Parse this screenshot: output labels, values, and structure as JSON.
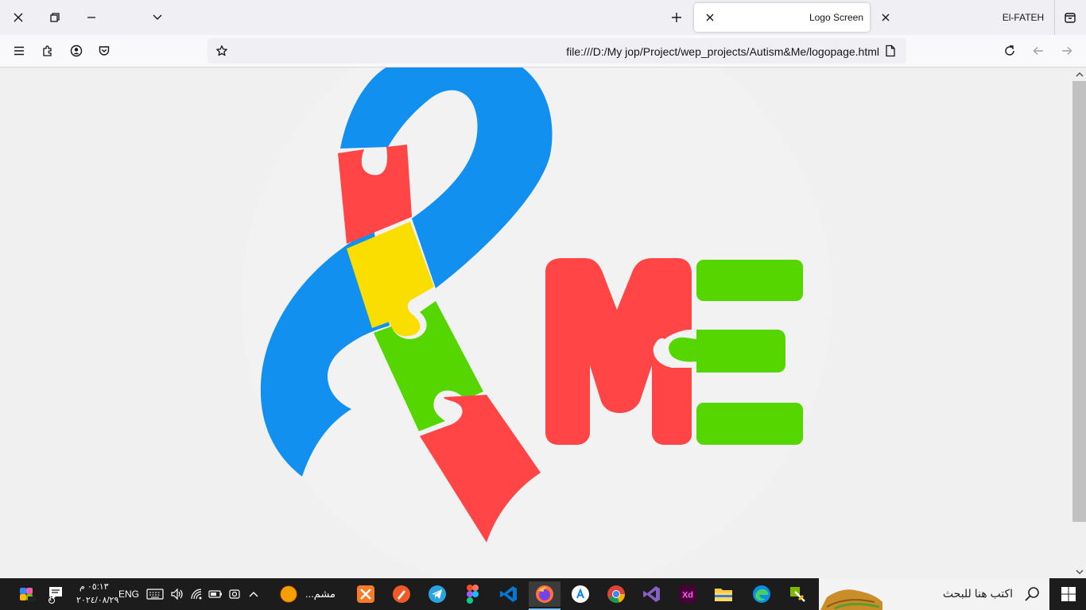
{
  "browser": {
    "tab_title": "Logo Screen",
    "profile_name": "El-FATEH",
    "url": "file:///D:/My jop/Project/wep_projects/Autism&Me/logopage.html"
  },
  "logo": {
    "text": "ME",
    "colors": {
      "blue": "#1190ef",
      "red": "#ff4545",
      "yellow": "#f9de00",
      "green": "#55d600"
    }
  },
  "taskbar": {
    "search_placeholder": "اكتب هنا للبحث",
    "app_label": "مشم...",
    "language": "ENG",
    "time": "٠٥:١٣ م",
    "date": "٢٠٢٤/٠٨/٢٩",
    "notification_count": "1"
  }
}
